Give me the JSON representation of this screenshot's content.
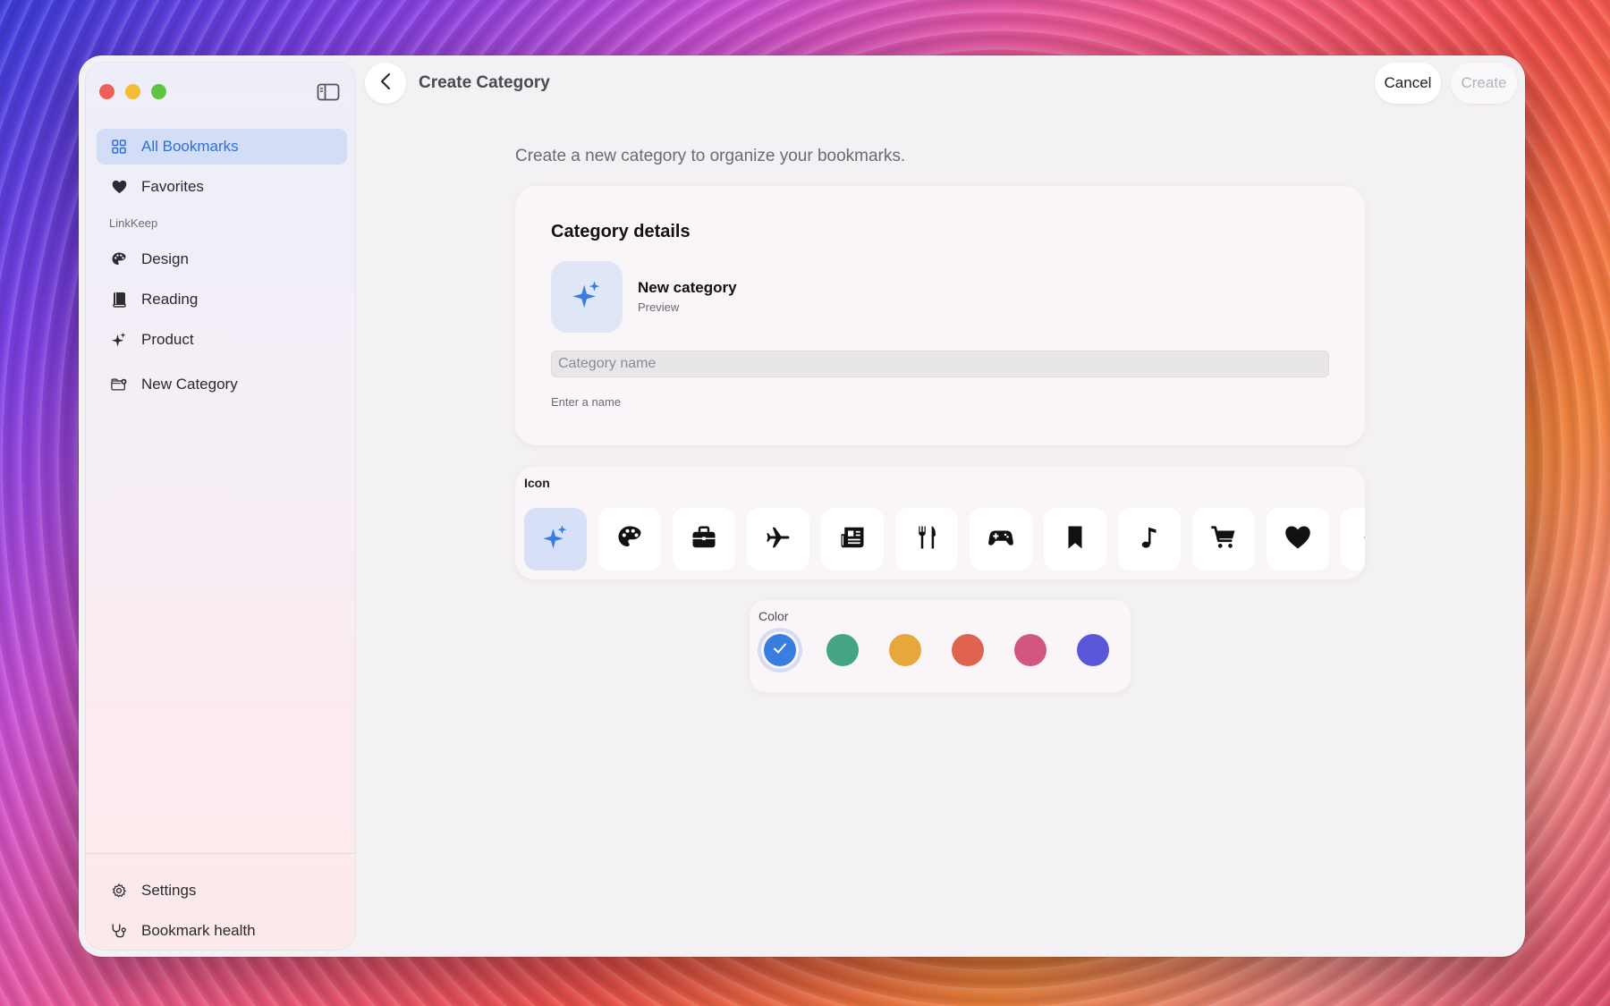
{
  "sidebar": {
    "items": [
      {
        "label": "All Bookmarks",
        "icon": "grid-icon"
      },
      {
        "label": "Favorites",
        "icon": "heart-icon"
      }
    ],
    "section_label": "LinkKeep",
    "categories": [
      {
        "label": "Design",
        "icon": "palette-icon"
      },
      {
        "label": "Reading",
        "icon": "book-icon"
      },
      {
        "label": "Product",
        "icon": "sparkles-icon"
      }
    ],
    "new_category_label": "New Category",
    "footer": [
      {
        "label": "Settings",
        "icon": "gear-icon"
      },
      {
        "label": "Bookmark health",
        "icon": "stethoscope-icon"
      }
    ]
  },
  "header": {
    "title": "Create Category",
    "cancel_label": "Cancel",
    "create_label": "Create"
  },
  "main": {
    "subtitle": "Create a new category to organize your bookmarks.",
    "details": {
      "title": "Category details",
      "preview_name": "New category",
      "preview_sub": "Preview",
      "name_placeholder": "Category name",
      "name_value": "",
      "hint": "Enter a name"
    },
    "icon_picker": {
      "label": "Icon",
      "icons": [
        "sparkles-icon",
        "palette-icon",
        "briefcase-icon",
        "airplane-icon",
        "newspaper-icon",
        "fork-knife-icon",
        "gamecontroller-icon",
        "bookmark-icon",
        "music-note-icon",
        "cart-icon",
        "heart-icon",
        "more-icon"
      ],
      "selected_index": 0
    },
    "color_picker": {
      "label": "Color",
      "colors": [
        "#3a7de0",
        "#44a585",
        "#e6a83a",
        "#e0634f",
        "#d2577f",
        "#5957d8"
      ],
      "selected_index": 0
    }
  },
  "colors": {
    "accent": "#2f6fd8",
    "active_bg": "#d3def6"
  }
}
